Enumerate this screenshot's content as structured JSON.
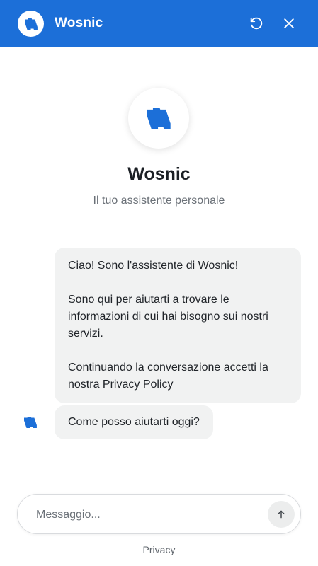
{
  "colors": {
    "header_bg": "#1c6fd8",
    "brand_logo": "#1c6fd8",
    "bubble_bg": "#f1f2f2"
  },
  "header": {
    "title": "Wosnic",
    "logo_icon": "wosnic-logo-icon",
    "restart_icon": "restart-icon",
    "close_icon": "close-icon"
  },
  "intro": {
    "name": "Wosnic",
    "subtitle": "Il tuo assistente personale"
  },
  "messages": [
    {
      "sender": "bot",
      "paragraphs": [
        "Ciao! Sono l'assistente di Wosnic!",
        "Sono qui per aiutarti a trovare le informazioni di cui hai bisogno sui nostri servizi.",
        "Continuando la conversazione accetti la nostra Privacy Policy"
      ]
    },
    {
      "sender": "bot",
      "text": "Come posso aiutarti oggi?"
    }
  ],
  "composer": {
    "placeholder": "Messaggio...",
    "value": "",
    "send_icon": "arrow-up-icon"
  },
  "footer": {
    "link": "Privacy"
  }
}
